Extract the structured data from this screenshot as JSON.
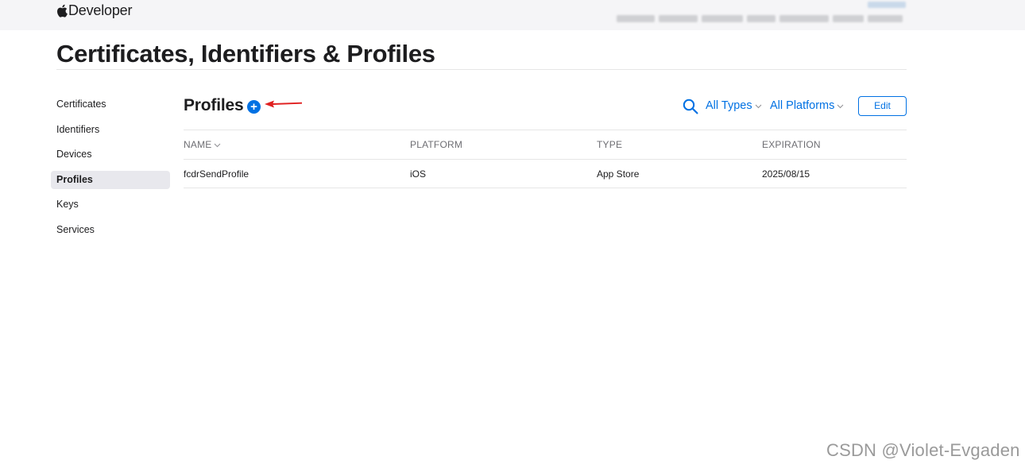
{
  "brand": {
    "label": "Developer"
  },
  "page": {
    "title": "Certificates, Identifiers & Profiles"
  },
  "sidebar": {
    "items": [
      {
        "label": "Certificates",
        "active": false
      },
      {
        "label": "Identifiers",
        "active": false
      },
      {
        "label": "Devices",
        "active": false
      },
      {
        "label": "Profiles",
        "active": true
      },
      {
        "label": "Keys",
        "active": false
      },
      {
        "label": "Services",
        "active": false
      }
    ]
  },
  "section": {
    "title": "Profiles",
    "add_label": "+",
    "filters": {
      "type": "All Types",
      "platform": "All Platforms"
    },
    "edit_label": "Edit"
  },
  "table": {
    "columns": [
      "NAME",
      "PLATFORM",
      "TYPE",
      "EXPIRATION"
    ],
    "rows": [
      [
        "fcdrSendProfile",
        "iOS",
        "App Store",
        "2025/08/15"
      ]
    ]
  },
  "watermark": "CSDN @Violet-Evgaden",
  "colors": {
    "accent": "#0071e3",
    "annotation_arrow": "#e02020",
    "active_bg": "#e8e8ed"
  },
  "icons": [
    "apple-logo-icon",
    "plus-icon",
    "search-icon",
    "chevron-down-icon",
    "red-arrow-annotation"
  ]
}
